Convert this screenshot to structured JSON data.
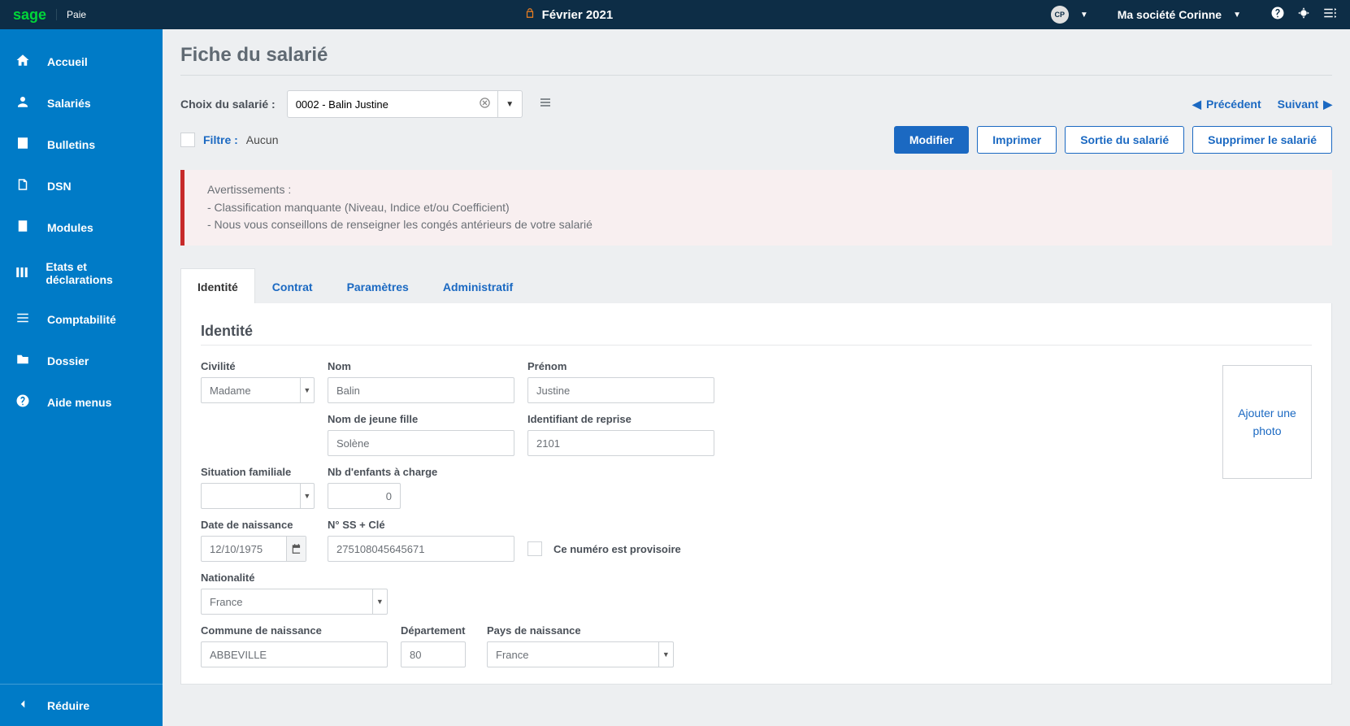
{
  "header": {
    "brand": "sage",
    "product": "Paie",
    "period": "Février 2021",
    "avatar": "CP",
    "company": "Ma société Corinne"
  },
  "sidebar": {
    "items": [
      {
        "icon": "home",
        "label": "Accueil"
      },
      {
        "icon": "employees",
        "label": "Salariés"
      },
      {
        "icon": "payslips",
        "label": "Bulletins"
      },
      {
        "icon": "dsn",
        "label": "DSN"
      },
      {
        "icon": "modules",
        "label": "Modules"
      },
      {
        "icon": "reports",
        "label": "Etats et déclarations"
      },
      {
        "icon": "accounting",
        "label": "Comptabilité"
      },
      {
        "icon": "folder",
        "label": "Dossier"
      },
      {
        "icon": "help",
        "label": "Aide menus"
      }
    ],
    "collapse": "Réduire"
  },
  "page": {
    "title": "Fiche du salarié",
    "choose_label": "Choix du salarié :",
    "employee_value": "0002 - Balin Justine",
    "prev": "Précédent",
    "next": "Suivant",
    "filter_label": "Filtre :",
    "filter_value": "Aucun",
    "buttons": {
      "modify": "Modifier",
      "print": "Imprimer",
      "exit": "Sortie du salarié",
      "delete": "Supprimer le salarié"
    },
    "alert": {
      "title": "Avertissements :",
      "lines": [
        "- Classification manquante (Niveau, Indice et/ou Coefficient)",
        "- Nous vous conseillons de renseigner les congés antérieurs de votre salarié"
      ]
    },
    "tabs": [
      "Identité",
      "Contrat",
      "Paramètres",
      "Administratif"
    ],
    "active_tab": 0,
    "section": "Identité",
    "photo_text": "Ajouter une photo",
    "fields": {
      "civility": {
        "label": "Civilité",
        "value": "Madame"
      },
      "nom": {
        "label": "Nom",
        "value": "Balin"
      },
      "prenom": {
        "label": "Prénom",
        "value": "Justine"
      },
      "maiden": {
        "label": "Nom de jeune fille",
        "value": "Solène"
      },
      "reprise": {
        "label": "Identifiant de reprise",
        "value": "2101"
      },
      "sitfam": {
        "label": "Situation familiale",
        "value": ""
      },
      "enfants": {
        "label": "Nb d'enfants à charge",
        "value": "0"
      },
      "dob": {
        "label": "Date de naissance",
        "value": "12/10/1975"
      },
      "ssn": {
        "label": "N° SS + Clé",
        "value": "275108045645671"
      },
      "ssn_temp": "Ce numéro est provisoire",
      "nat": {
        "label": "Nationalité",
        "value": "France"
      },
      "commune": {
        "label": "Commune de naissance",
        "value": "ABBEVILLE"
      },
      "dept": {
        "label": "Département",
        "value": "80"
      },
      "pays": {
        "label": "Pays de naissance",
        "value": "France"
      }
    }
  }
}
